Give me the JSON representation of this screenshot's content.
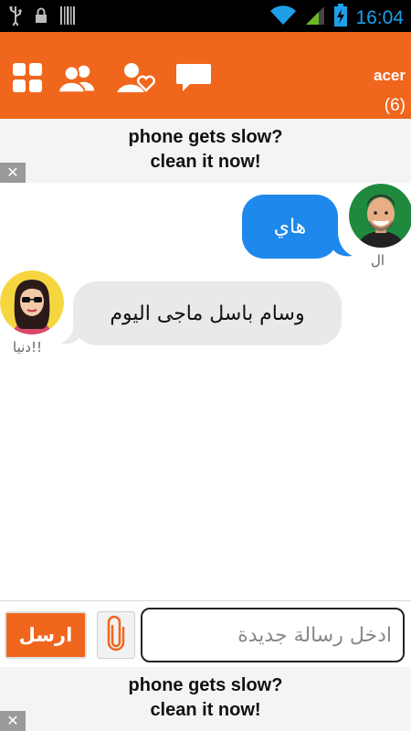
{
  "status_bar": {
    "time": "16:04",
    "icons": [
      "usb-icon",
      "lock-icon",
      "barcode-icon",
      "wifi-icon",
      "signal-icon",
      "battery-charging-icon"
    ],
    "time_color": "#1ea0e8"
  },
  "top_bar": {
    "background": "#f0661c",
    "icons": [
      "grid-menu-icon",
      "contacts-icon",
      "favorite-contacts-icon",
      "chat-icon"
    ],
    "user_name": "acer",
    "count": "(6)"
  },
  "ad_top": {
    "line1": "phone gets slow?",
    "line2": "clean it now!",
    "close_label": "✕"
  },
  "messages": [
    {
      "side": "right",
      "text": "هاي",
      "sender": "ال",
      "avatar": "male-avatar",
      "bubble_color": "#1e88ec"
    },
    {
      "side": "left",
      "text": "وسام باسل ماجى اليوم",
      "sender": "دنيا!!",
      "avatar": "female-avatar",
      "bubble_color": "#e9e9ec"
    }
  ],
  "composer": {
    "send_label": "ارسل",
    "placeholder": "ادخل رسالة جديدة",
    "attach_icon": "paperclip-icon"
  },
  "ad_bottom": {
    "line1": "phone gets slow?",
    "line2": "clean it now!",
    "close_label": "✕"
  }
}
